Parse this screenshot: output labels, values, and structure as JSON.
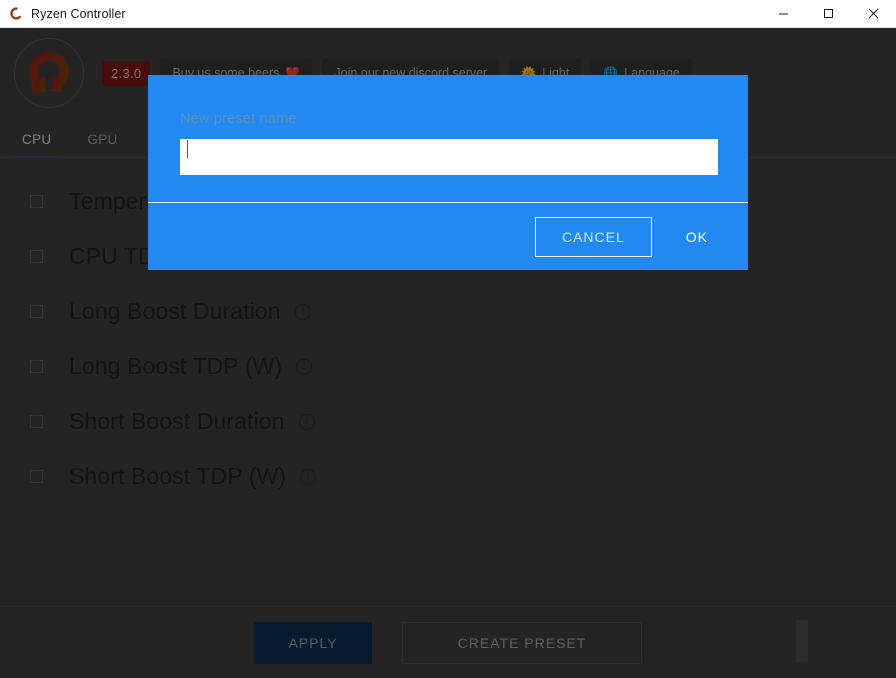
{
  "titlebar": {
    "title": "Ryzen Controller",
    "app_icon": "ryzen-logo-icon",
    "minimize_label": "—",
    "maximize_label": "□",
    "close_label": "✕"
  },
  "header": {
    "logo_icon": "ryzen-omega-logo",
    "version": "2.3.0",
    "buttons": [
      {
        "label": "Buy us some beers",
        "emoji": "❤️",
        "icon": "heart-icon"
      },
      {
        "label": "Join our new discord server",
        "emoji": "",
        "icon": "discord-icon"
      },
      {
        "label": "Light",
        "emoji": "🌞",
        "icon": "sun-icon"
      },
      {
        "label": "Language",
        "emoji": "🌐",
        "icon": "globe-icon"
      }
    ]
  },
  "tabs": [
    {
      "label": "CPU",
      "active": true
    },
    {
      "label": "GPU",
      "active": false
    }
  ],
  "settings_list": [
    {
      "label": "Temperature Limit (°C)",
      "checked": false,
      "has_info": true
    },
    {
      "label": "CPU TDP (W)",
      "checked": false,
      "has_info": true
    },
    {
      "label": "Long Boost Duration",
      "checked": false,
      "has_info": true
    },
    {
      "label": "Long Boost TDP (W)",
      "checked": false,
      "has_info": true
    },
    {
      "label": "Short Boost Duration",
      "checked": false,
      "has_info": true
    },
    {
      "label": "Short Boost TDP (W)",
      "checked": false,
      "has_info": true
    }
  ],
  "footer": {
    "apply_label": "APPLY",
    "create_preset_label": "CREATE PRESET"
  },
  "dialog": {
    "label": "New preset name",
    "input_value": "",
    "input_placeholder": "",
    "cancel_label": "CANCEL",
    "ok_label": "OK"
  },
  "colors": {
    "dialog_blue": "#2189f0",
    "window_bg": "#3c3c3c",
    "apply_blue": "#0d2c4d",
    "version_red": "#7a1414",
    "tab_underline": "#2b4a6b"
  }
}
